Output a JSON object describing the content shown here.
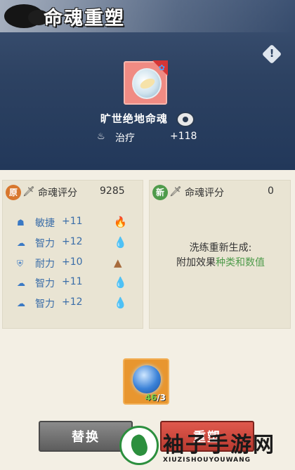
{
  "header": {
    "title": "命魂重塑"
  },
  "soul": {
    "name": "旷世绝地命魂",
    "stat_label": "治疗",
    "stat_value": "+118"
  },
  "original": {
    "badge": "原",
    "score_label": "命魂评分",
    "score_value": "9285",
    "attributes": [
      {
        "label": "敏捷",
        "value": "+11",
        "element": "fire"
      },
      {
        "label": "智力",
        "value": "+12",
        "element": "water"
      },
      {
        "label": "耐力",
        "value": "+10",
        "element": "earth"
      },
      {
        "label": "智力",
        "value": "+11",
        "element": "water"
      },
      {
        "label": "智力",
        "value": "+12",
        "element": "water"
      }
    ]
  },
  "new": {
    "badge": "新",
    "score_label": "命魂评分",
    "score_value": "0",
    "reroll_line1": "洗练重新生成:",
    "reroll_line2_prefix": "附加效果",
    "reroll_line2_highlight": "种类和数值"
  },
  "item": {
    "have": "46",
    "need": "3",
    "slash": "/"
  },
  "buttons": {
    "swap": "替换",
    "reroll": "重塑"
  },
  "watermark": {
    "text": "袖子手游网",
    "sub": "XIUZISHOUYOUWANG"
  },
  "colors": {
    "accent_green": "#4f9b4b",
    "accent_orange": "#d8772e",
    "header_blue": "#2d4262",
    "reroll_red": "#c8453a"
  }
}
